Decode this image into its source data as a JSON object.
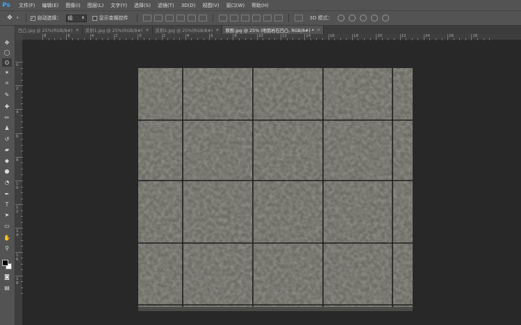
{
  "app": {
    "logo": "Ps"
  },
  "menu": [
    "文件(F)",
    "编辑(E)",
    "图像(I)",
    "图层(L)",
    "文字(Y)",
    "选择(S)",
    "滤镜(T)",
    "3D(D)",
    "视图(V)",
    "窗口(W)",
    "帮助(H)"
  ],
  "options": {
    "tool_icon": "move-tool-icon",
    "auto_select_label": "自动选择：",
    "auto_select_value": "组",
    "show_transform_label": "显示变换控件",
    "mode3d_label": "3D 模式："
  },
  "tabs": [
    {
      "label": "凹凸.jpg @ 25%(RGB/8#)",
      "close": "×"
    },
    {
      "label": "反射1.jpg @ 25%(RGB/8#)",
      "close": "×"
    },
    {
      "label": "反射2.jpg @ 25%(RGB/8#)",
      "close": "×"
    },
    {
      "label": "原图.jpg @ 25% (地面岩石凹凸, RGB/8#) *",
      "close": "×"
    }
  ],
  "ruler_h_labels": [
    "8",
    "6",
    "4",
    "2",
    "0",
    "2",
    "4",
    "6",
    "8",
    "10",
    "12",
    "14",
    "16",
    "18",
    "20",
    "22",
    "24",
    "26",
    "28"
  ],
  "ruler_v_labels": [
    "0",
    "2",
    "4",
    "6",
    "8",
    "1\n0",
    "1\n2",
    "1\n4",
    "1\n6",
    "1\n8"
  ],
  "colors": {
    "foreground": "#000000",
    "background": "#ffffff",
    "tile": "#6e6e66",
    "grout": "#1e1e1e"
  }
}
